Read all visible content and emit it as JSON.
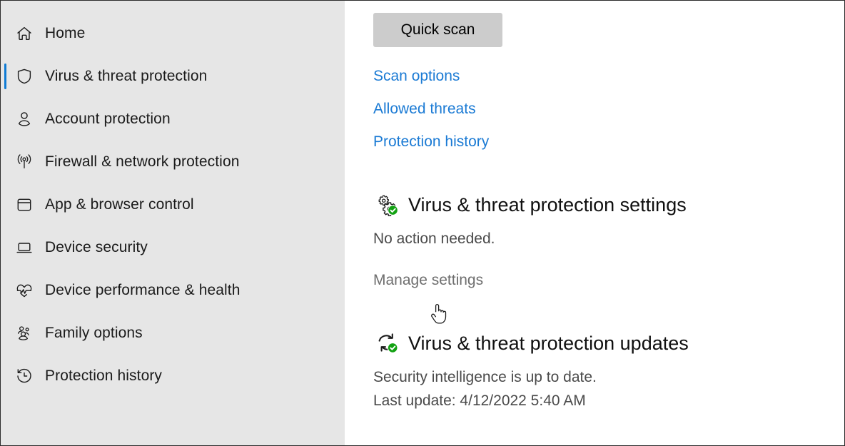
{
  "accent_blue": "#1a7ad4",
  "selection_bar_color": "#0f7bd4",
  "sidebar_bg": "#e6e6e6",
  "button_bg": "#cccccc",
  "status_green": "#12a112",
  "sidebar": {
    "items": [
      {
        "label": "Home",
        "icon": "home-icon",
        "selected": false
      },
      {
        "label": "Virus & threat protection",
        "icon": "shield-icon",
        "selected": true
      },
      {
        "label": "Account protection",
        "icon": "person-icon",
        "selected": false
      },
      {
        "label": "Firewall & network protection",
        "icon": "broadcast-icon",
        "selected": false
      },
      {
        "label": "App & browser control",
        "icon": "window-app-icon",
        "selected": false
      },
      {
        "label": "Device security",
        "icon": "laptop-icon",
        "selected": false
      },
      {
        "label": "Device performance & health",
        "icon": "heart-pulse-icon",
        "selected": false
      },
      {
        "label": "Family options",
        "icon": "people-group-icon",
        "selected": false
      },
      {
        "label": "Protection history",
        "icon": "history-clock-icon",
        "selected": false
      }
    ]
  },
  "main": {
    "quick_scan_label": "Quick scan",
    "links": [
      {
        "label": "Scan options"
      },
      {
        "label": "Allowed threats"
      },
      {
        "label": "Protection history"
      }
    ],
    "sections": [
      {
        "icon": "gears-check-icon",
        "title": "Virus & threat protection settings",
        "status": "No action needed.",
        "action": "Manage settings"
      },
      {
        "icon": "refresh-check-icon",
        "title": "Virus & threat protection updates",
        "status": "Security intelligence is up to date.",
        "sub": "Last update: 4/12/2022 5:40 AM"
      }
    ]
  },
  "cursor": {
    "type": "pointing-hand-cursor"
  }
}
